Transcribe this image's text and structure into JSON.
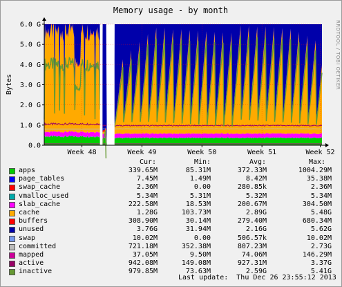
{
  "chart_data": {
    "type": "area",
    "title": "Memory usage - by month",
    "ylabel": "Bytes",
    "side_label": "RRDTOOL / TOBI OETIKER",
    "ylim": [
      0,
      6.0
    ],
    "y_unit": "G",
    "y_ticks": [
      "0.0",
      "1.0 G",
      "2.0 G",
      "3.0 G",
      "4.0 G",
      "5.0 G",
      "6.0 G"
    ],
    "x_ticks": [
      "Week 48",
      "Week 49",
      "Week 50",
      "Week 51",
      "Week 52"
    ],
    "x_tick_days": [
      4.4,
      11.4,
      18.4,
      25.4,
      32.2
    ],
    "x_range_days": [
      0,
      32.4
    ],
    "gap_days": [
      [
        6.5,
        6.8
      ],
      [
        7.3,
        8.2
      ]
    ],
    "series": [
      {
        "name": "apps",
        "color": "#00cc00",
        "cur": "339.65M",
        "min": "85.31M",
        "avg": "372.33M",
        "max": "1004.29M"
      },
      {
        "name": "page_tables",
        "color": "#0000ff",
        "cur": "7.45M",
        "min": "1.49M",
        "avg": "8.42M",
        "max": "35.38M"
      },
      {
        "name": "swap_cache",
        "color": "#ff0000",
        "cur": "2.36M",
        "min": "0.00",
        "avg": "280.85k",
        "max": "2.36M"
      },
      {
        "name": "vmalloc_used",
        "color": "#00aaaa",
        "cur": "5.34M",
        "min": "5.31M",
        "avg": "5.32M",
        "max": "5.34M"
      },
      {
        "name": "slab_cache",
        "color": "#ff00ff",
        "cur": "222.58M",
        "min": "18.53M",
        "avg": "200.67M",
        "max": "304.50M"
      },
      {
        "name": "cache",
        "color": "#ffaa00",
        "cur": "1.28G",
        "min": "103.73M",
        "avg": "2.89G",
        "max": "5.48G"
      },
      {
        "name": "buffers",
        "color": "#ff0000",
        "cur": "308.90M",
        "min": "30.14M",
        "avg": "279.40M",
        "max": "680.34M"
      },
      {
        "name": "unused",
        "color": "#0000aa",
        "cur": "3.76G",
        "min": "31.94M",
        "avg": "2.16G",
        "max": "5.62G"
      },
      {
        "name": "swap",
        "color": "#7799ee",
        "cur": "10.02M",
        "min": "0.00",
        "avg": "506.57k",
        "max": "10.02M"
      },
      {
        "name": "committed",
        "color": "#bbbbbb",
        "cur": "721.18M",
        "min": "352.38M",
        "avg": "807.23M",
        "max": "2.73G"
      },
      {
        "name": "mapped",
        "color": "#cc0099",
        "cur": "37.05M",
        "min": "9.50M",
        "avg": "74.06M",
        "max": "146.29M"
      },
      {
        "name": "active",
        "color": "#990066",
        "cur": "942.08M",
        "min": "149.08M",
        "avg": "927.31M",
        "max": "3.37G"
      },
      {
        "name": "inactive",
        "color": "#669933",
        "cur": "979.85M",
        "min": "73.63M",
        "avg": "2.59G",
        "max": "5.41G"
      }
    ],
    "stack_order": [
      "apps",
      "page_tables",
      "swap_cache",
      "vmalloc_used",
      "slab_cache",
      "cache",
      "buffers",
      "unused",
      "swap"
    ],
    "line_series": [
      "committed",
      "mapped",
      "active",
      "inactive"
    ]
  },
  "legend_headers": {
    "cur": "Cur:",
    "min": "Min:",
    "avg": "Avg:",
    "max": "Max:"
  },
  "last_update": "Last update:  Thu Dec 26 23:55:12 2013",
  "colors": {
    "background": "#f0f0f0",
    "canvas": "#ffffff",
    "grid": "#ff0000",
    "axis": "#000000"
  }
}
